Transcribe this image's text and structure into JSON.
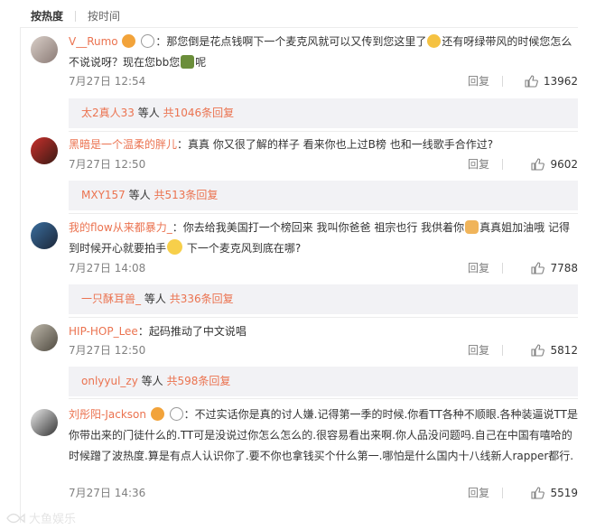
{
  "tabs": {
    "hot": "按热度",
    "time": "按时间"
  },
  "colors": {
    "username": "#eb7350",
    "meta": "#808080",
    "subbox_bg": "#f2f2f5"
  },
  "comments": [
    {
      "user": "V__Rumo",
      "text_a": "：那您倒是花点钱啊下一个麦克风就可以又传到您这里了",
      "text_b": "还有呀绿带风的时候您怎么不说说呀？现在您bb您",
      "text_c": "呢",
      "time": "7月27日 12:54",
      "reply": "回复",
      "likes": "13962",
      "sub_user": "太2真人33",
      "sub_mid": "等人",
      "sub_count": "共1046条回复"
    },
    {
      "user": "黑暗是一个温柔的胖儿",
      "text_a": "：真真 你又很了解的样子  看来你也上过B榜 也和一线歌手合作过?",
      "time": "7月27日 12:50",
      "reply": "回复",
      "likes": "9602",
      "sub_user": "MXY157",
      "sub_mid": "等人",
      "sub_count": "共513条回复"
    },
    {
      "user": "我的flow从来都暴力_",
      "text_a": "：你去给我美国打一个榜回来 我叫你爸爸 祖宗也行 我供着你",
      "text_b": "真真姐加油哦 记得到时候开心就要拍手",
      "text_c": "下一个麦克风到底在哪?",
      "time": "7月27日 14:08",
      "reply": "回复",
      "likes": "7788",
      "sub_user": "一只酥耳兽_",
      "sub_mid": "等人",
      "sub_count": "共336条回复"
    },
    {
      "user": "HIP-HOP_Lee",
      "text_a": "：起码推动了中文说唱",
      "time": "7月27日 12:50",
      "reply": "回复",
      "likes": "5812",
      "sub_user": "onlyyul_zy",
      "sub_mid": "等人",
      "sub_count": "共598条回复"
    },
    {
      "user": "刘彤阳-Jackson",
      "text_a": "：不过实话你是真的讨人嫌.记得第一季的时候.你看TT各种不顺眼.各种装逼说TT是你带出来的门徒什么的.TT可是没说过你怎么怎么的.很容易看出来啊.你人品没问题吗.自己在中国有嘻哈的时候蹭了波热度.算是有点人认识你了.要不你也拿钱买个什么第一.哪怕是什么国内十八线新人rapper都行.",
      "time": "7月27日 14:36",
      "reply": "回复",
      "likes": "5519"
    }
  ],
  "watermark": "大鱼娱乐"
}
